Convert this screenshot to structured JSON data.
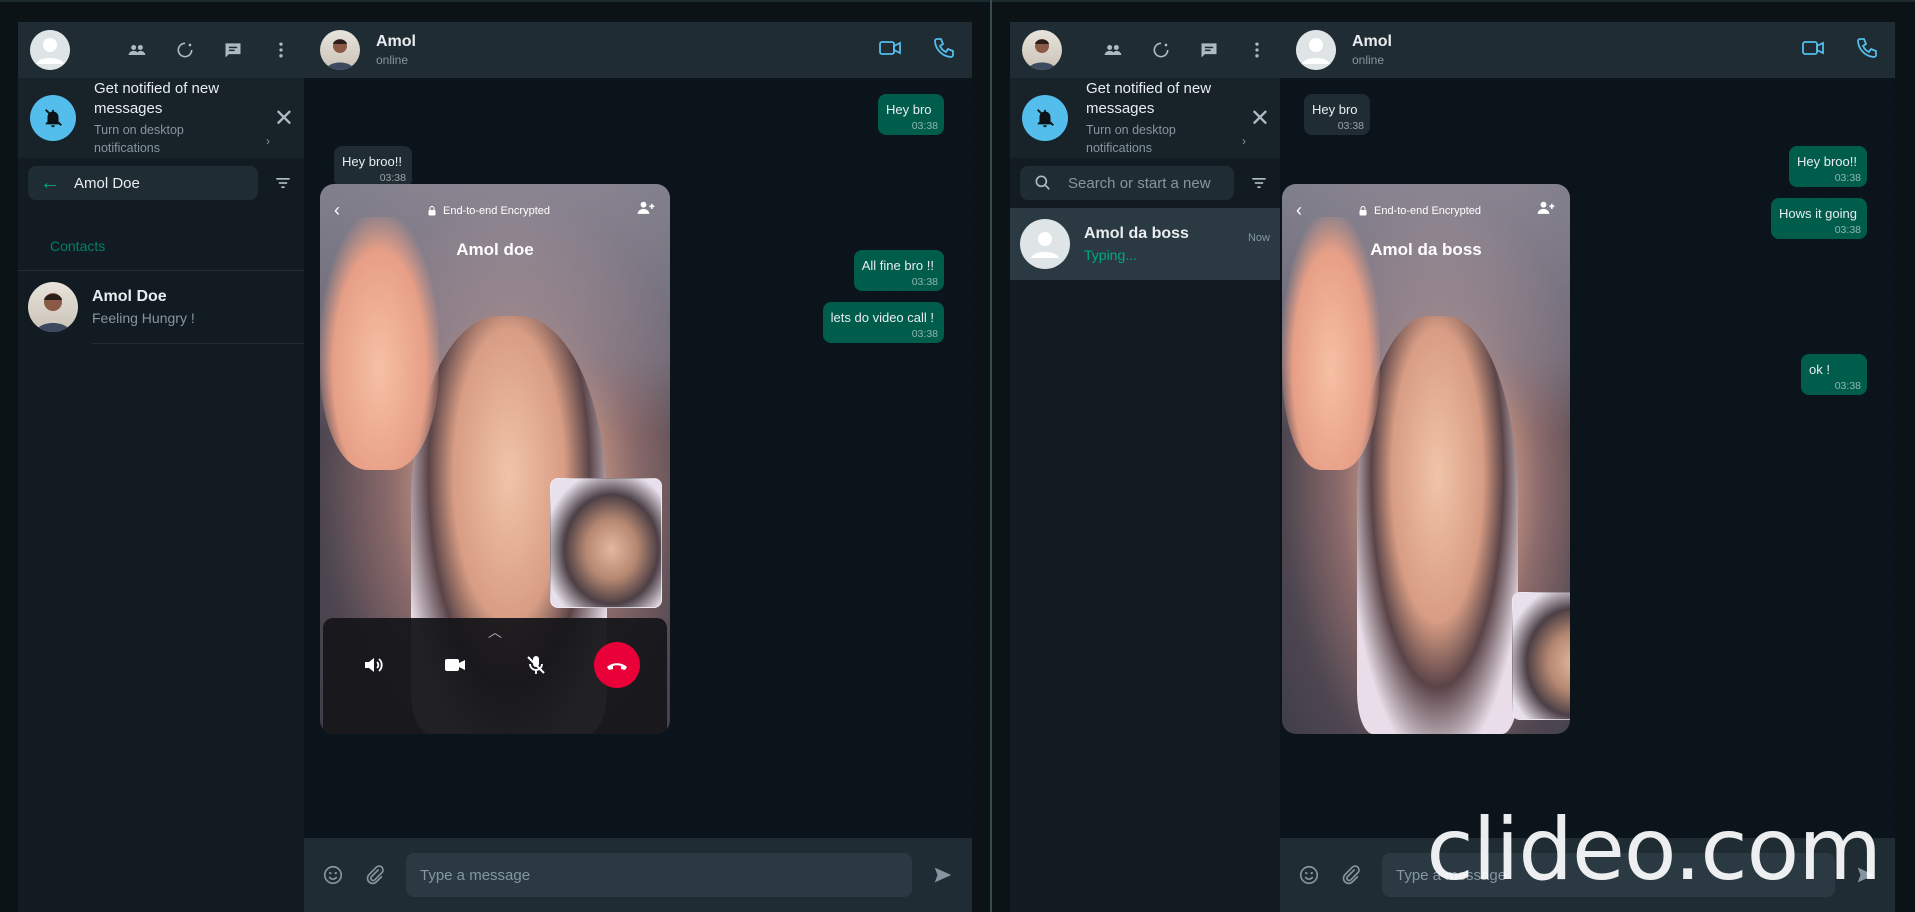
{
  "left": {
    "notification": {
      "title": "Get notified of new messages",
      "subtitle": "Turn on desktop notifications"
    },
    "search": {
      "value": "Amol Doe"
    },
    "contacts_label": "Contacts",
    "contacts": [
      {
        "name": "Amol Doe",
        "status": "Feeling Hungry !"
      }
    ],
    "chat": {
      "name": "Amol",
      "status": "online",
      "messages": [
        {
          "text": "Hey bro",
          "time": "03:38",
          "dir": "out"
        },
        {
          "text": "Hey broo!!",
          "time": "03:38",
          "dir": "in"
        },
        {
          "text": "All fine bro !!",
          "time": "03:38",
          "dir": "out"
        },
        {
          "text": "lets do video call !",
          "time": "03:38",
          "dir": "out"
        }
      ],
      "video_call": {
        "encryption_label": "End-to-end Encrypted",
        "caller_name": "Amol doe"
      },
      "composer_placeholder": "Type a message"
    }
  },
  "right": {
    "notification": {
      "title": "Get notified of new messages",
      "subtitle": "Turn on desktop notifications"
    },
    "search": {
      "placeholder": "Search or start a new"
    },
    "chats": [
      {
        "name": "Amol da boss",
        "preview": "Typing...",
        "time": "Now"
      }
    ],
    "chat": {
      "name": "Amol",
      "status": "online",
      "messages": [
        {
          "text": "Hey bro",
          "time": "03:38",
          "dir": "in"
        },
        {
          "text": "Hey broo!!",
          "time": "03:38",
          "dir": "out"
        },
        {
          "text": "Hows it going",
          "time": "03:38",
          "dir": "out"
        },
        {
          "text": "ok !",
          "time": "03:38",
          "dir": "out"
        }
      ],
      "video_call": {
        "encryption_label": "End-to-end Encrypted",
        "caller_name": "Amol da boss"
      },
      "composer_placeholder": "Type a message"
    }
  },
  "watermark": "clideo.com",
  "colors": {
    "accent": "#00a884",
    "outgoing_bubble": "#005c4b",
    "incoming_bubble": "#202c33",
    "end_call": "#ea0038",
    "notification_icon": "#53bdeb"
  }
}
